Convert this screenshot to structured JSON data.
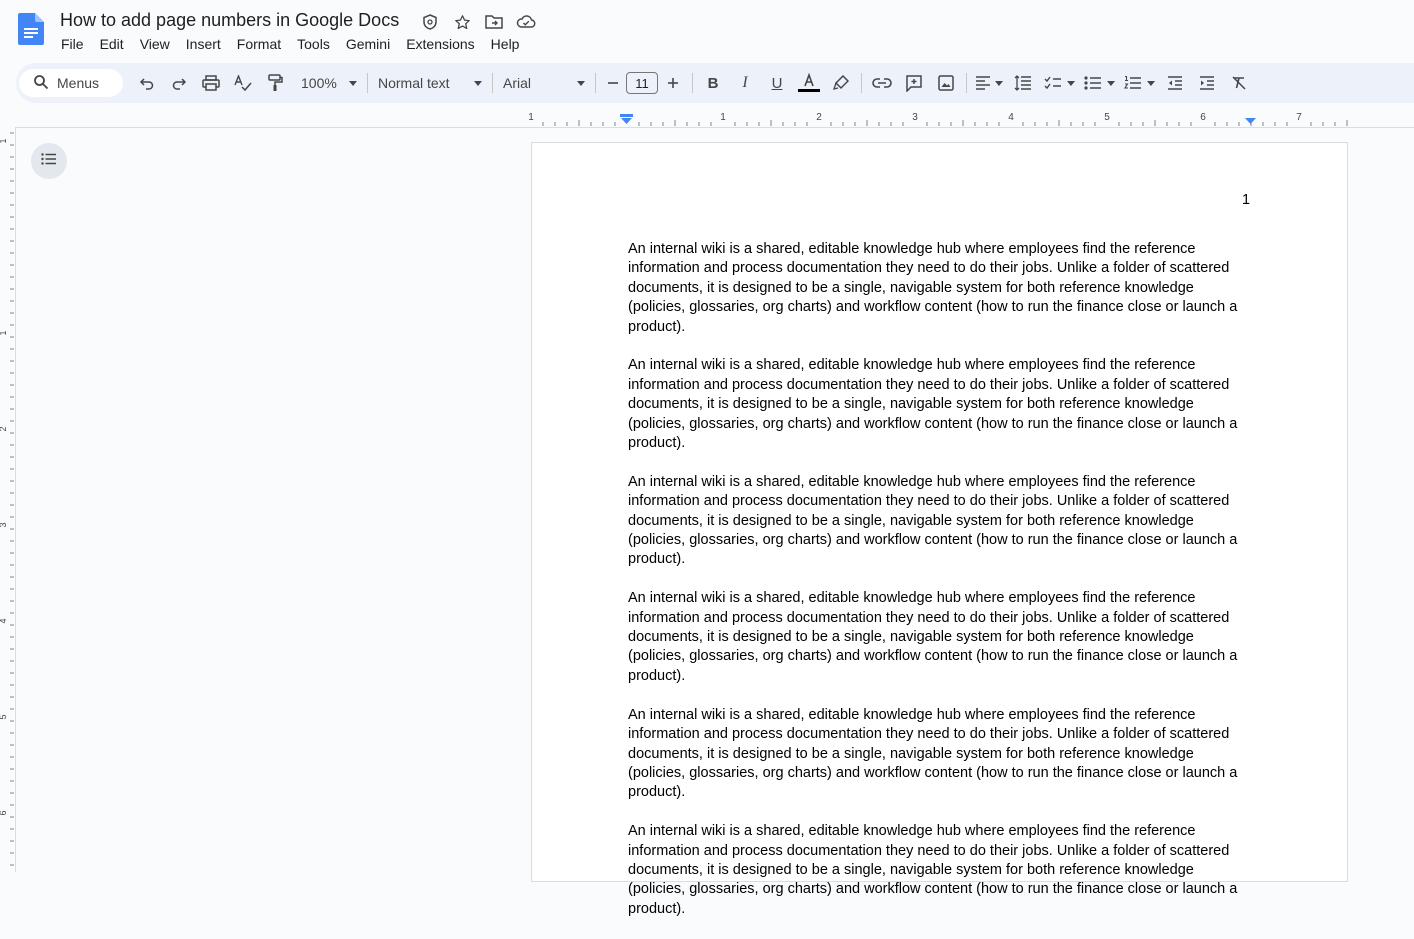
{
  "header": {
    "title": "How to add page numbers in Google Docs",
    "app_icon": "docs-logo-icon",
    "title_icons": [
      "security-shield-icon",
      "star-icon",
      "move-folder-icon",
      "cloud-saved-icon"
    ]
  },
  "menus": [
    "File",
    "Edit",
    "View",
    "Insert",
    "Format",
    "Tools",
    "Gemini",
    "Extensions",
    "Help"
  ],
  "toolbar": {
    "search_placeholder": "Menus",
    "zoom": "100%",
    "style": "Normal text",
    "font": "Arial",
    "font_size": "11",
    "text_color": "#000000"
  },
  "ruler": {
    "h_labels": [
      "1",
      "1",
      "2",
      "3",
      "4",
      "5",
      "6",
      "7"
    ],
    "v_labels": [
      "1",
      "1",
      "2",
      "3",
      "4",
      "5",
      "6"
    ]
  },
  "document": {
    "page_number": "1",
    "paragraphs": [
      "An internal wiki is a shared, editable knowledge hub where employees find the reference information and process documentation they need to do their jobs. Unlike a folder of scattered documents, it is designed to be a single, navigable system for both reference knowledge (policies, glossaries, org charts) and workflow content (how to run the finance close or launch a product).",
      "An internal wiki is a shared, editable knowledge hub where employees find the reference information and process documentation they need to do their jobs. Unlike a folder of scattered documents, it is designed to be a single, navigable system for both reference knowledge (policies, glossaries, org charts) and workflow content (how to run the finance close or launch a product).",
      "An internal wiki is a shared, editable knowledge hub where employees find the reference information and process documentation they need to do their jobs. Unlike a folder of scattered documents, it is designed to be a single, navigable system for both reference knowledge (policies, glossaries, org charts) and workflow content (how to run the finance close or launch a product).",
      "An internal wiki is a shared, editable knowledge hub where employees find the reference information and process documentation they need to do their jobs. Unlike a folder of scattered documents, it is designed to be a single, navigable system for both reference knowledge (policies, glossaries, org charts) and workflow content (how to run the finance close or launch a product).",
      "An internal wiki is a shared, editable knowledge hub where employees find the reference information and process documentation they need to do their jobs. Unlike a folder of scattered documents, it is designed to be a single, navigable system for both reference knowledge (policies, glossaries, org charts) and workflow content (how to run the finance close or launch a product).",
      "An internal wiki is a shared, editable knowledge hub where employees find the reference information and process documentation they need to do their jobs. Unlike a folder of scattered documents, it is designed to be a single, navigable system for both reference knowledge (policies, glossaries, org charts) and workflow content (how to run the finance close or launch a product)."
    ]
  }
}
